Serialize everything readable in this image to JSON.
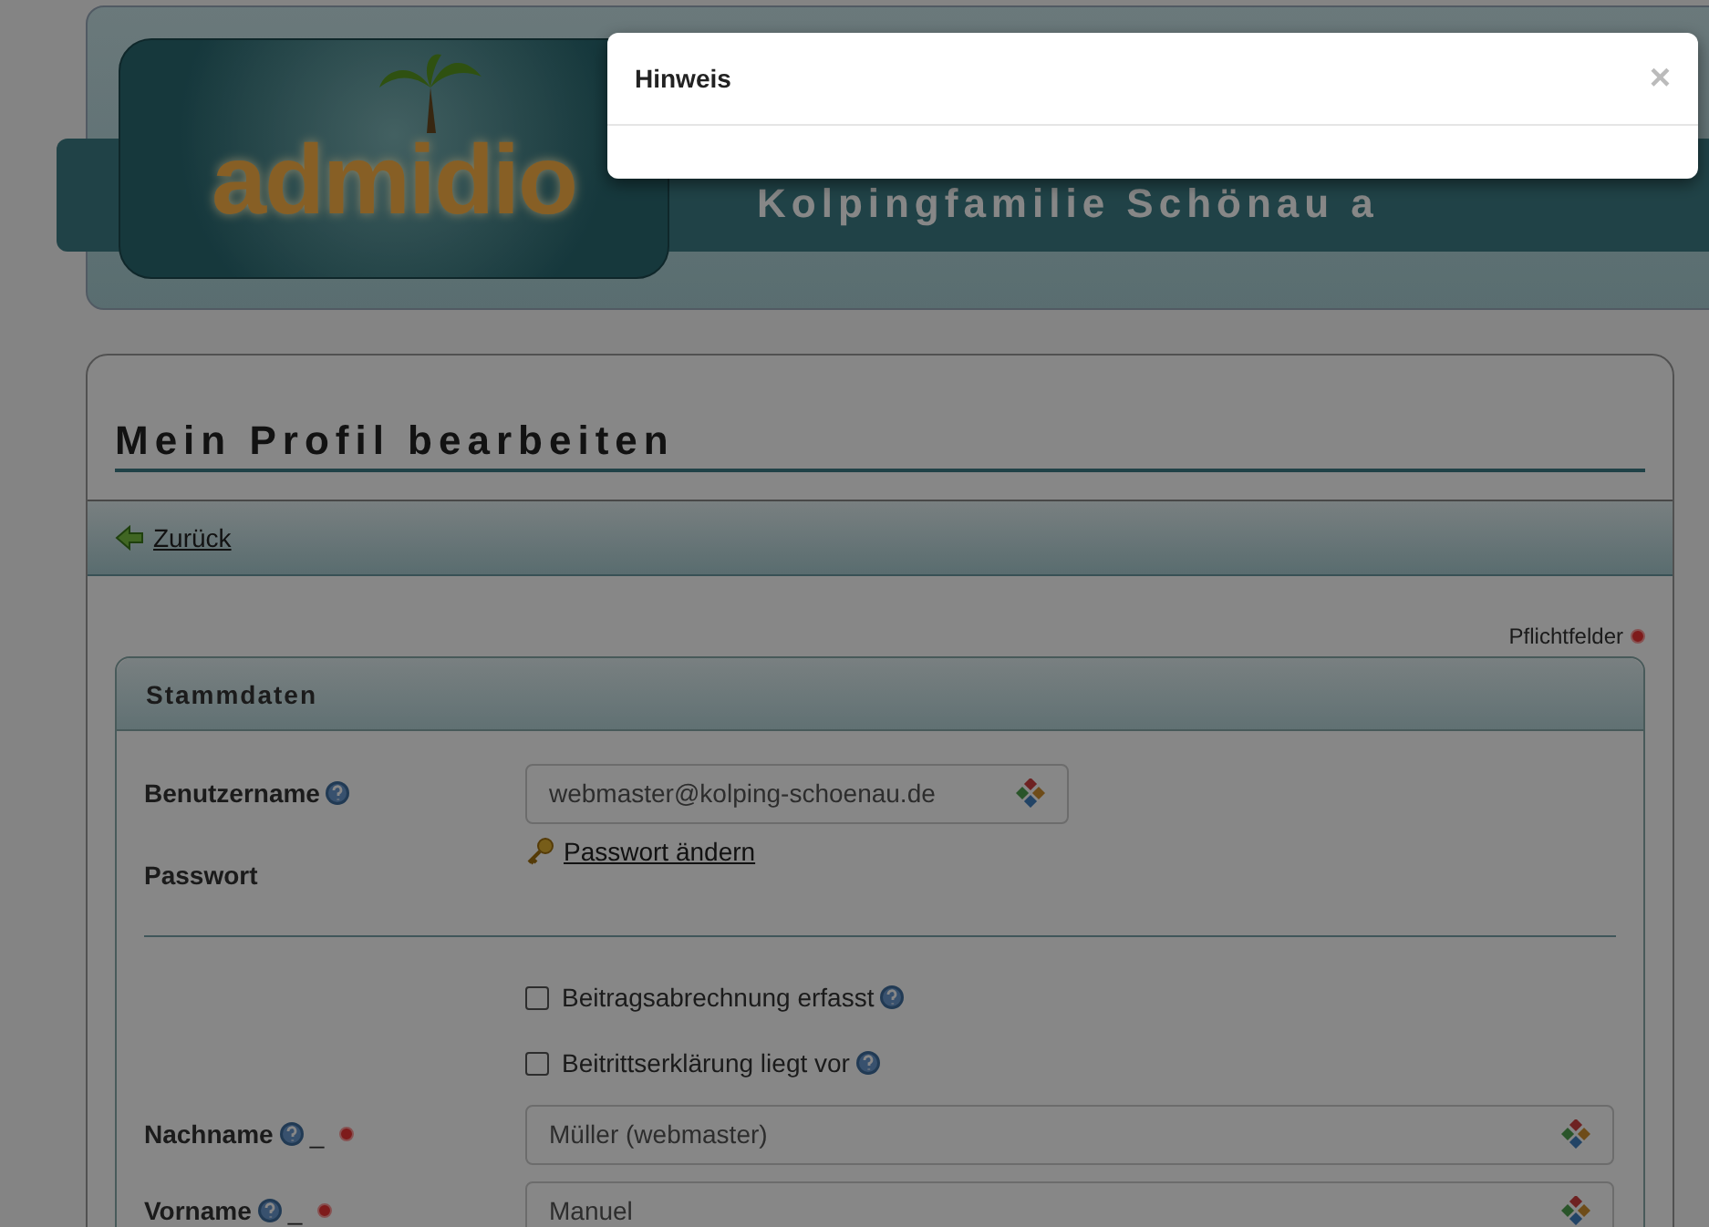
{
  "header": {
    "logo": "admidio",
    "title": "Kolpingfamilie Schönau a"
  },
  "modal": {
    "title": "Hinweis",
    "close": "×"
  },
  "page": {
    "title": "Mein Profil bearbeiten",
    "back_link": "Zurück",
    "required_note": "Pflichtfelder"
  },
  "panel": {
    "title": "Stammdaten",
    "fields": [
      {
        "kind": "short-input",
        "label": "Benutzername",
        "help": true,
        "value": "webmaster@kolping-schoenau.de"
      },
      {
        "kind": "link",
        "label": "Passwort",
        "help": false,
        "value": "Passwort ändern"
      },
      {
        "kind": "divider"
      },
      {
        "kind": "checkbox",
        "text": "Beitragsabrechnung erfasst",
        "checked": false,
        "help": true
      },
      {
        "kind": "checkbox",
        "text": "Beitrittserklärung liegt vor",
        "checked": false,
        "help": true
      },
      {
        "kind": "input",
        "label": "Nachname",
        "help": true,
        "marker": "_",
        "required": true,
        "value": "Müller (webmaster)"
      },
      {
        "kind": "input",
        "label": "Vorname",
        "help": true,
        "marker": "_",
        "required": true,
        "value": "Manuel"
      }
    ]
  }
}
